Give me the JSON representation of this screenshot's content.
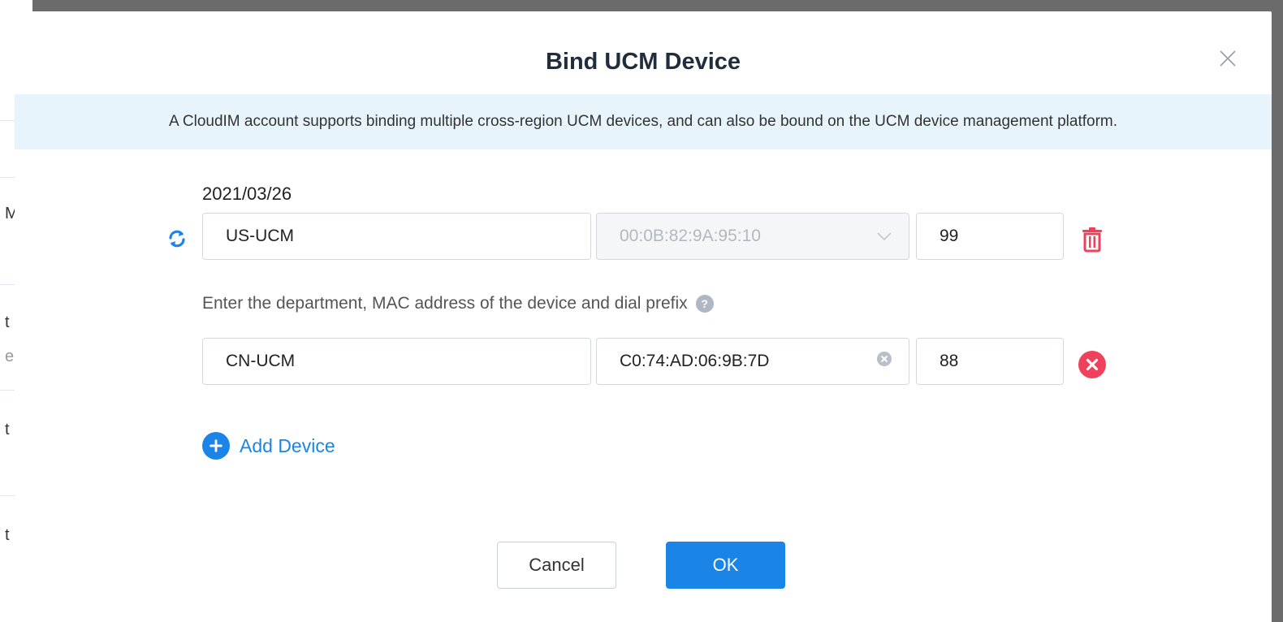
{
  "background": {
    "fragments": [
      "M",
      "t",
      "e",
      "t",
      "t"
    ]
  },
  "dialog": {
    "title": "Bind UCM Device",
    "notice": "A CloudIM account supports binding multiple cross-region UCM devices, and can also be bound on the UCM device management platform.",
    "bound_device": {
      "date": "2021/03/26",
      "department": "US-UCM",
      "mac": "00:0B:82:9A:95:10",
      "prefix": "99"
    },
    "hint": "Enter the department, MAC address of the device and dial prefix",
    "new_device": {
      "department": "CN-UCM",
      "mac": "C0:74:AD:06:9B:7D",
      "prefix": "88"
    },
    "add_device_label": "Add Device",
    "cancel_label": "Cancel",
    "ok_label": "OK"
  },
  "colors": {
    "accent": "#1a85e6",
    "danger": "#f0415a",
    "notice_bg": "#e8f4fb"
  },
  "icons": [
    "close-icon",
    "refresh-icon",
    "chevron-down-icon",
    "trash-icon",
    "help-icon",
    "clear-icon",
    "remove-icon",
    "plus-icon"
  ]
}
